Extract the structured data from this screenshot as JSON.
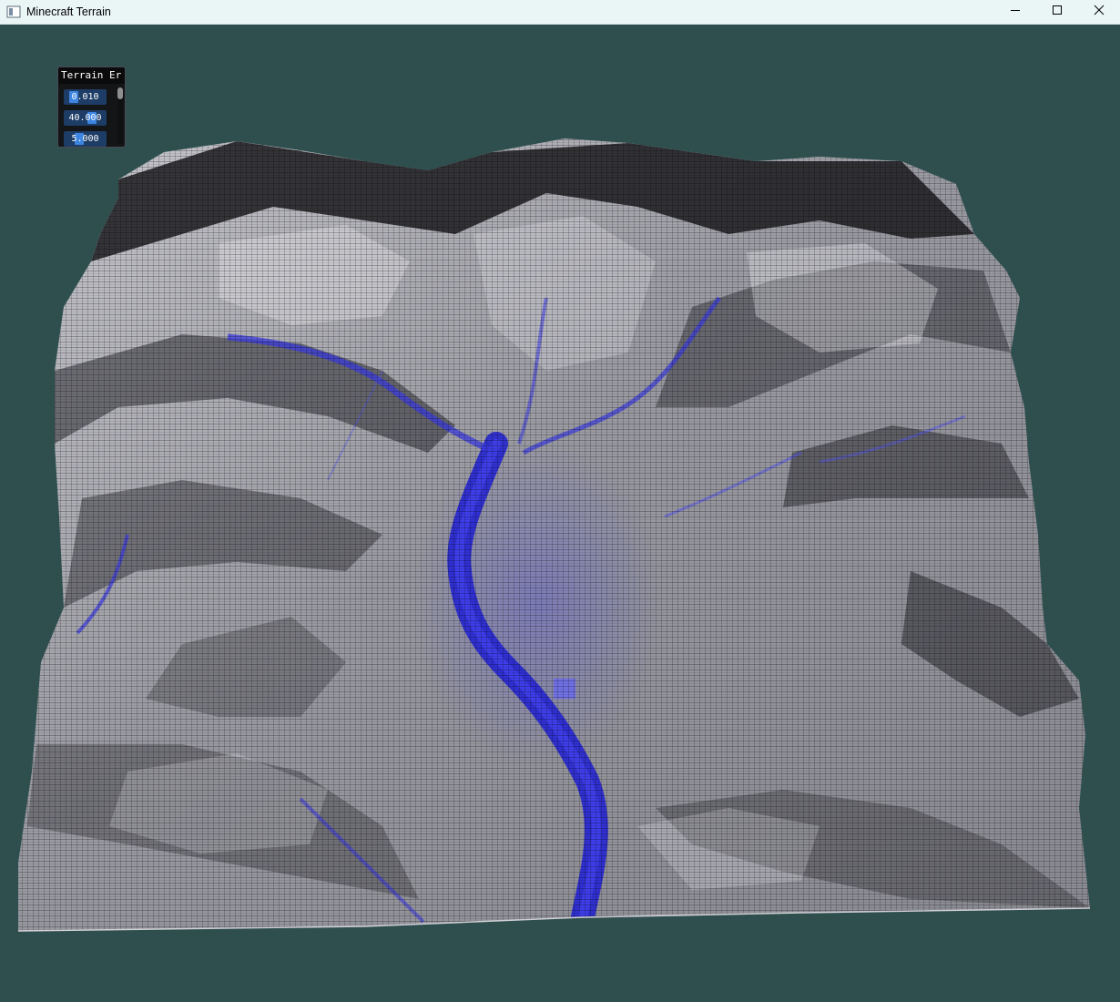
{
  "window": {
    "title": "Minecraft Terrain",
    "controls": {
      "minimize": "minimize-icon",
      "maximize": "maximize-icon",
      "close": "close-icon"
    }
  },
  "panel": {
    "title": "Terrain Er",
    "sliders": [
      {
        "value_text": "0.010",
        "value": 0.01,
        "fill_fraction": 0.3
      },
      {
        "value_text": "40.000",
        "value": 40.0,
        "fill_fraction": 0.55
      },
      {
        "value_text": "5.000",
        "value": 5.0,
        "fill_fraction": 0.28
      }
    ]
  },
  "colors": {
    "background": "#2f4f4f",
    "terrain_light": "#e2e2e8",
    "terrain_dark": "#1b1b1f",
    "river": "#2a2ad8",
    "slider_frame": "#1d3c66",
    "slider_grab": "#3d85e0"
  }
}
